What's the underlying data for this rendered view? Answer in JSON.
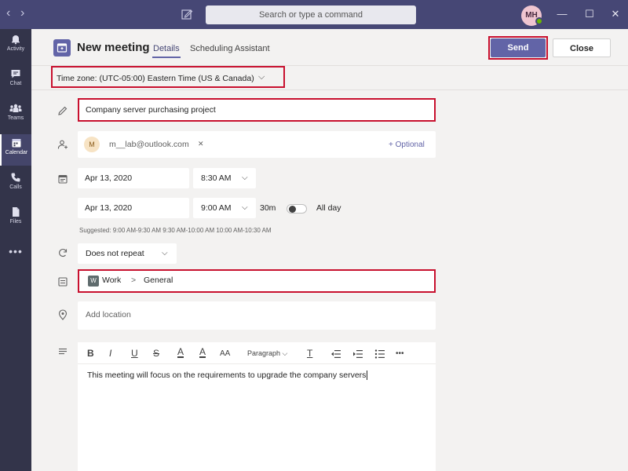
{
  "titlebar": {
    "search_placeholder": "Search or type a command",
    "avatar_initials": "MH",
    "back_glyph": "‹",
    "forward_glyph": "›",
    "minimize_glyph": "—",
    "maximize_glyph": "☐",
    "close_glyph": "✕"
  },
  "rail": {
    "items": [
      {
        "label": "Activity",
        "icon": "bell-icon"
      },
      {
        "label": "Chat",
        "icon": "chat-icon"
      },
      {
        "label": "Teams",
        "icon": "teams-icon"
      },
      {
        "label": "Calendar",
        "icon": "calendar-icon"
      },
      {
        "label": "Calls",
        "icon": "phone-icon"
      },
      {
        "label": "Files",
        "icon": "file-icon"
      }
    ],
    "more": "•••"
  },
  "header": {
    "title": "New meeting",
    "tabs": [
      "Details",
      "Scheduling Assistant"
    ],
    "send_label": "Send",
    "close_label": "Close"
  },
  "timezone": {
    "label": "Time zone: (UTC-05:00) Eastern Time (US & Canada)",
    "chevron": "⌵"
  },
  "form": {
    "title_value": "Company server purchasing project",
    "attendee": {
      "initial": "M",
      "email": "m__lab@outlook.com",
      "remove": "✕"
    },
    "optional_label": "+ Optional",
    "start_date": "Apr 13, 2020",
    "start_time": "8:30 AM",
    "end_date": "Apr 13, 2020",
    "end_time": "9:00 AM",
    "duration": "30m",
    "all_day_label": "All day",
    "all_day_on": false,
    "suggested": "Suggested:  9:00 AM-9:30 AM   9:30 AM-10:00 AM   10:00 AM-10:30 AM",
    "repeat": "Does not repeat",
    "channel_badge": "W",
    "channel_team": "Work",
    "channel_separator": ">",
    "channel_name": "General",
    "location_placeholder": "Add location"
  },
  "editor": {
    "toolbar": {
      "bold": "B",
      "italic": "I",
      "underline": "U",
      "strike": "S",
      "highlight": "A",
      "font_color": "A",
      "font_size": "AA",
      "paragraph": "Paragraph ⌵",
      "clear_format": "T",
      "more": "•••"
    },
    "body": "This meeting will focus on the requirements to upgrade the company servers"
  },
  "colors": {
    "accent": "#6264a7",
    "titlebar": "#464775",
    "rail": "#33344a",
    "highlight_box": "#c8102e"
  }
}
